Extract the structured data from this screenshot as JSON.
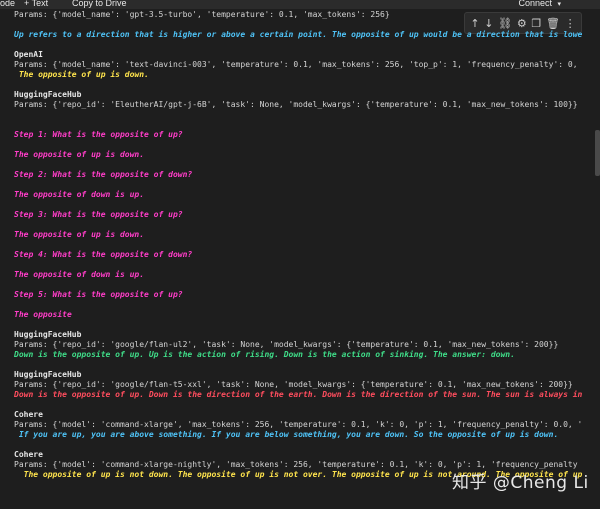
{
  "toolbar": {
    "left_label": "ode",
    "add_text": "+ Text",
    "copy_to_drive": "Copy to Drive",
    "connect": "Connect",
    "connect_caret": "▾"
  },
  "cell_tools": [
    "move-up-icon",
    "move-down-icon",
    "link-icon",
    "settings-icon",
    "mirror-cell-icon",
    "delete-icon",
    "more-icon"
  ],
  "cell_tool_glyphs": [
    "↑",
    "↓",
    "⛓",
    "⚙",
    "❐",
    "🗑",
    "⋮"
  ],
  "output": {
    "l01": "Params: {'model_name': 'gpt-3.5-turbo', 'temperature': 0.1, 'max_tokens': 256}",
    "l02": "",
    "l03": "Up refers to a direction that is higher or above a certain point. The opposite of up would be a direction that is lowe",
    "l04": "",
    "l05": "OpenAI",
    "l06": "Params: {'model_name': 'text-davinci-003', 'temperature': 0.1, 'max_tokens': 256, 'top_p': 1, 'frequency_penalty': 0,",
    "l07": " The opposite of up is down.",
    "l08": "",
    "l09": "HuggingFaceHub",
    "l10": "Params: {'repo_id': 'EleutherAI/gpt-j-6B', 'task': None, 'model_kwargs': {'temperature': 0.1, 'max_new_tokens': 100}}",
    "l11": "",
    "l12": "",
    "l13": "Step 1: What is the opposite of up?",
    "l14": "",
    "l15": "The opposite of up is down.",
    "l16": "",
    "l17": "Step 2: What is the opposite of down?",
    "l18": "",
    "l19": "The opposite of down is up.",
    "l20": "",
    "l21": "Step 3: What is the opposite of up?",
    "l22": "",
    "l23": "The opposite of up is down.",
    "l24": "",
    "l25": "Step 4: What is the opposite of down?",
    "l26": "",
    "l27": "The opposite of down is up.",
    "l28": "",
    "l29": "Step 5: What is the opposite of up?",
    "l30": "",
    "l31": "The opposite",
    "l32": "",
    "l33": "HuggingFaceHub",
    "l34": "Params: {'repo_id': 'google/flan-ul2', 'task': None, 'model_kwargs': {'temperature': 0.1, 'max_new_tokens': 200}}",
    "l35": "Down is the opposite of up. Up is the action of rising. Down is the action of sinking. The answer: down.",
    "l36": "",
    "l37": "HuggingFaceHub",
    "l38": "Params: {'repo_id': 'google/flan-t5-xxl', 'task': None, 'model_kwargs': {'temperature': 0.1, 'max_new_tokens': 200}}",
    "l39": "Down is the opposite of up. Down is the direction of the earth. Down is the direction of the sun. The sun is always in",
    "l40": "",
    "l41": "Cohere",
    "l42": "Params: {'model': 'command-xlarge', 'max_tokens': 256, 'temperature': 0.1, 'k': 0, 'p': 1, 'frequency_penalty': 0.0, '",
    "l43": " If you are up, you are above something. If you are below something, you are down. So the opposite of up is down.",
    "l44": "",
    "l45": "Cohere",
    "l46": "Params: {'model': 'command-xlarge-nightly', 'max_tokens': 256, 'temperature': 0.1, 'k': 0, 'p': 1, 'frequency_penalty",
    "l47": "  The opposite of up is not down. The opposite of up is not over. The opposite of up is not around. The opposite of up"
  },
  "watermark": "知乎 @Cheng Li"
}
